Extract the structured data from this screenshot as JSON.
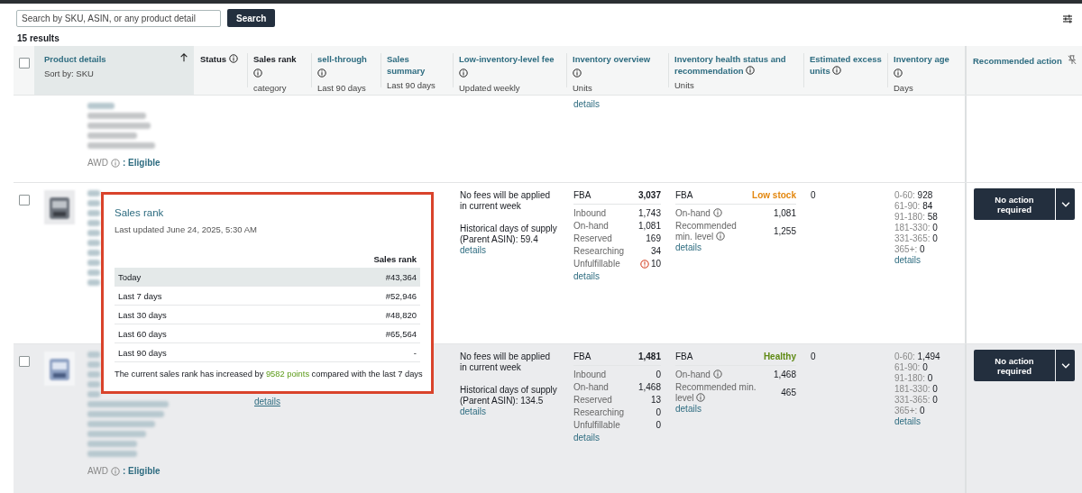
{
  "search": {
    "placeholder": "Search by SKU, ASIN, or any product detail",
    "button": "Search"
  },
  "results_count": "15 results",
  "table": {
    "header_checked": false,
    "columns": [
      {
        "title": "Product details",
        "sub": "Sort by: SKU",
        "link": true,
        "sorted": true,
        "kind": "plain"
      },
      {
        "title": "Status",
        "link": false,
        "sorted": false,
        "kind": "info_inline"
      },
      {
        "title": "Sales rank",
        "sub": "category",
        "link": false,
        "sorted": false,
        "kind": "info_below"
      },
      {
        "title": "sell-through",
        "sub": "Last 90 days",
        "link": true,
        "sorted": false,
        "kind": "info_below"
      },
      {
        "title": "Sales summary",
        "sub": "Last 90 days",
        "link": true,
        "sorted": false,
        "kind": "plain"
      },
      {
        "title": "Low-inventory-level fee",
        "sub": "Updated weekly",
        "link": true,
        "sorted": false,
        "kind": "info_below"
      },
      {
        "title": "Inventory overview",
        "sub": "Units",
        "link": true,
        "sorted": false,
        "kind": "info_below"
      },
      {
        "title": "Inventory health status and recommendation",
        "sub": "Units",
        "link": true,
        "sorted": false,
        "kind": "info_inline"
      },
      {
        "title": "Estimated excess units",
        "link": true,
        "sorted": false,
        "kind": "info_inline"
      },
      {
        "title": "Inventory age",
        "sub": "Days",
        "link": true,
        "sorted": false,
        "kind": "info_below"
      },
      {
        "title": "Recommended action",
        "link": true,
        "sorted": false,
        "kind": "pin"
      }
    ],
    "rows": [
      {
        "kind": "partial",
        "hovered": false,
        "awd": "AWD",
        "awd_status": ": Eligible",
        "overview_link": "details"
      },
      {
        "kind": "full",
        "checked": false,
        "hovered": false,
        "fee": {
          "note": "No fees will be applied in current week",
          "supply": "Historical days of supply (Parent ASIN): 59.4",
          "link": "details"
        },
        "overview": {
          "head": "FBA",
          "total": "3,037",
          "items": [
            {
              "label": "Inbound",
              "value": "1,743",
              "alert": false
            },
            {
              "label": "On-hand",
              "value": "1,081",
              "alert": false
            },
            {
              "label": "Reserved",
              "value": "169",
              "alert": false
            },
            {
              "label": "Researching",
              "value": "34",
              "alert": false
            },
            {
              "label": "Unfulfillable",
              "value": "10",
              "alert": true
            }
          ],
          "link": "details"
        },
        "health": {
          "head": "FBA",
          "status": "Low stock",
          "color": "#e3870e",
          "items": [
            {
              "label": "On-hand",
              "value": "1,081"
            },
            {
              "label": "Recommended min. level",
              "value": "1,255"
            }
          ],
          "link": "details"
        },
        "excess": "0",
        "age": {
          "items": [
            {
              "range": "0-60:",
              "value": "928"
            },
            {
              "range": "61-90:",
              "value": "84"
            },
            {
              "range": "91-180:",
              "value": "58"
            },
            {
              "range": "181-330:",
              "value": "0"
            },
            {
              "range": "331-365:",
              "value": "0"
            },
            {
              "range": "365+:",
              "value": "0"
            }
          ],
          "link": "details"
        },
        "action": "No action required"
      },
      {
        "kind": "full",
        "checked": false,
        "hovered": true,
        "sales_link": "details",
        "awd": "AWD",
        "awd_status": ": Eligible",
        "fee": {
          "note": "No fees will be applied in current week",
          "supply": "Historical days of supply (Parent ASIN): 134.5",
          "link": "details"
        },
        "overview": {
          "head": "FBA",
          "total": "1,481",
          "items": [
            {
              "label": "Inbound",
              "value": "0",
              "alert": false
            },
            {
              "label": "On-hand",
              "value": "1,468",
              "alert": false
            },
            {
              "label": "Reserved",
              "value": "13",
              "alert": false
            },
            {
              "label": "Researching",
              "value": "0",
              "alert": false
            },
            {
              "label": "Unfulfillable",
              "value": "0",
              "alert": false
            }
          ],
          "link": "details"
        },
        "health": {
          "head": "FBA",
          "status": "Healthy",
          "color": "#5f8a14",
          "items": [
            {
              "label": "On-hand",
              "value": "1,468"
            },
            {
              "label": "Recommended min. level",
              "value": "465"
            }
          ],
          "link": "details"
        },
        "excess": "0",
        "age": {
          "items": [
            {
              "range": "0-60:",
              "value": "1,494"
            },
            {
              "range": "61-90:",
              "value": "0"
            },
            {
              "range": "91-180:",
              "value": "0"
            },
            {
              "range": "181-330:",
              "value": "0"
            },
            {
              "range": "331-365:",
              "value": "0"
            },
            {
              "range": "365+:",
              "value": "0"
            }
          ],
          "link": "details"
        },
        "action": "No action required"
      }
    ]
  },
  "popup": {
    "title": "Sales rank",
    "updated": "Last updated June 24, 2025, 5:30 AM",
    "column": "Sales rank",
    "rows": [
      {
        "label": "Today",
        "value": "#43,364",
        "selected": true
      },
      {
        "label": "Last 7 days",
        "value": "#52,946",
        "selected": false
      },
      {
        "label": "Last 30 days",
        "value": "#48,820",
        "selected": false
      },
      {
        "label": "Last 60 days",
        "value": "#65,564",
        "selected": false
      },
      {
        "label": "Last 90 days",
        "value": "-",
        "selected": false
      }
    ],
    "footer": {
      "before": "The current sales rank has increased by",
      "highlight": "9582 points",
      "after": "compared with the last 7 days"
    }
  }
}
